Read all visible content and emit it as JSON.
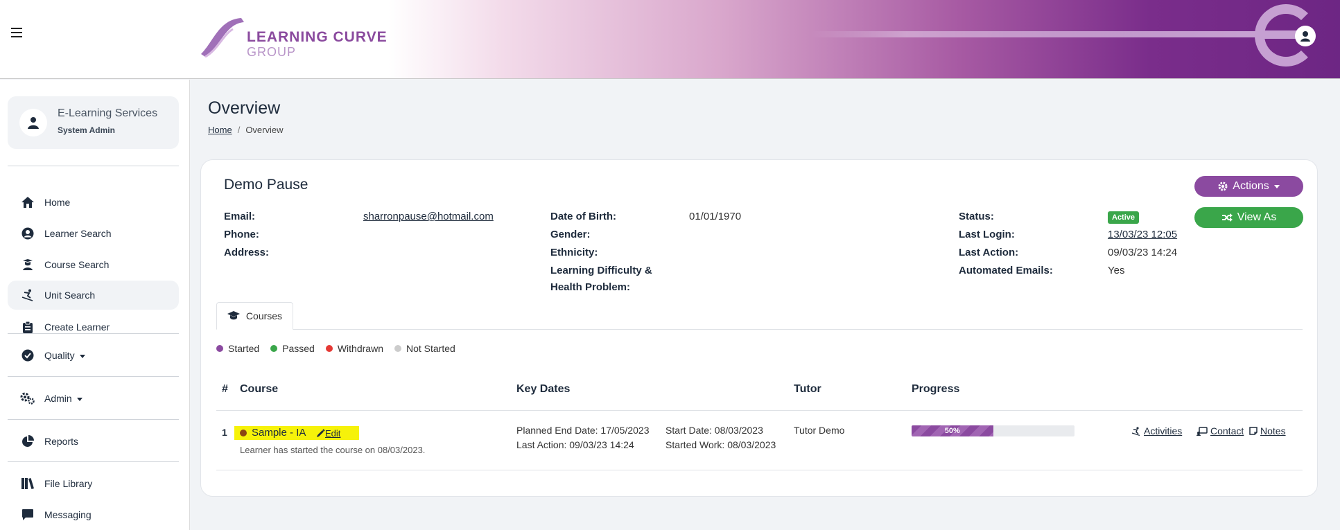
{
  "header": {
    "logo_line1": "LEARNING CURVE",
    "logo_line2": "GROUP"
  },
  "sidebar": {
    "user": {
      "name": "E-Learning Services",
      "role": "System Admin"
    },
    "items": [
      {
        "label": "Home",
        "icon": "home-icon"
      },
      {
        "label": "Learner Search",
        "icon": "user-circle-icon"
      },
      {
        "label": "Course Search",
        "icon": "graduate-icon"
      },
      {
        "label": "Unit Search",
        "icon": "skier-icon",
        "active": true
      },
      {
        "label": "Create Learner",
        "icon": "clipboard-icon"
      },
      {
        "label": "Quality",
        "icon": "check-circle-icon",
        "dropdown": true
      },
      {
        "label": "Admin",
        "icon": "gears-icon",
        "dropdown": true
      },
      {
        "label": "Reports",
        "icon": "pie-chart-icon"
      },
      {
        "label": "File Library",
        "icon": "books-icon"
      },
      {
        "label": "Messaging",
        "icon": "chat-icon"
      }
    ]
  },
  "page": {
    "title": "Overview",
    "breadcrumb": {
      "home": "Home",
      "sep": "/",
      "current": "Overview"
    }
  },
  "learner": {
    "name": "Demo Pause",
    "fields": {
      "email_label": "Email:",
      "email": "sharronpause@hotmail.com",
      "phone_label": "Phone:",
      "phone": "",
      "address_label": "Address:",
      "address": "",
      "dob_label": "Date of Birth:",
      "dob": "01/01/1970",
      "gender_label": "Gender:",
      "gender": "",
      "ethnicity_label": "Ethnicity:",
      "ethnicity": "",
      "ldhp_label_line1": "Learning Difficulty &",
      "ldhp_label_line2": "Health Problem:",
      "status_label": "Status:",
      "status": "Active",
      "last_login_label": "Last Login:",
      "last_login": "13/03/23 12:05",
      "last_action_label": "Last Action:",
      "last_action": "09/03/23 14:24",
      "auto_emails_label": "Automated Emails:",
      "auto_emails": "Yes"
    },
    "buttons": {
      "actions": "Actions",
      "view_as": "View As"
    }
  },
  "tabs": [
    {
      "label": "Courses",
      "icon": "graduation-cap-icon"
    }
  ],
  "legend": [
    {
      "label": "Started",
      "color": "#8b4aa0"
    },
    {
      "label": "Passed",
      "color": "#3aa64a"
    },
    {
      "label": "Withdrawn",
      "color": "#e53935"
    },
    {
      "label": "Not Started",
      "color": "#cccccc"
    }
  ],
  "table": {
    "headers": {
      "num": "#",
      "course": "Course",
      "key_dates": "Key Dates",
      "tutor": "Tutor",
      "progress": "Progress"
    },
    "rows": [
      {
        "num": "1",
        "course": "Sample - IA",
        "edit": " Edit",
        "note": "Learner has started the course on 08/03/2023.",
        "planned_end": "Planned End Date: 17/05/2023",
        "last_action": "Last Action: 09/03/23 14:24",
        "start_date": "Start Date: 08/03/2023",
        "started_work": "Started Work: 08/03/2023",
        "tutor": "Tutor Demo",
        "progress": 50,
        "progress_label": "50%",
        "actions": {
          "activities": "Activities",
          "contact": "Contact",
          "notes": "Notes"
        }
      }
    ]
  }
}
